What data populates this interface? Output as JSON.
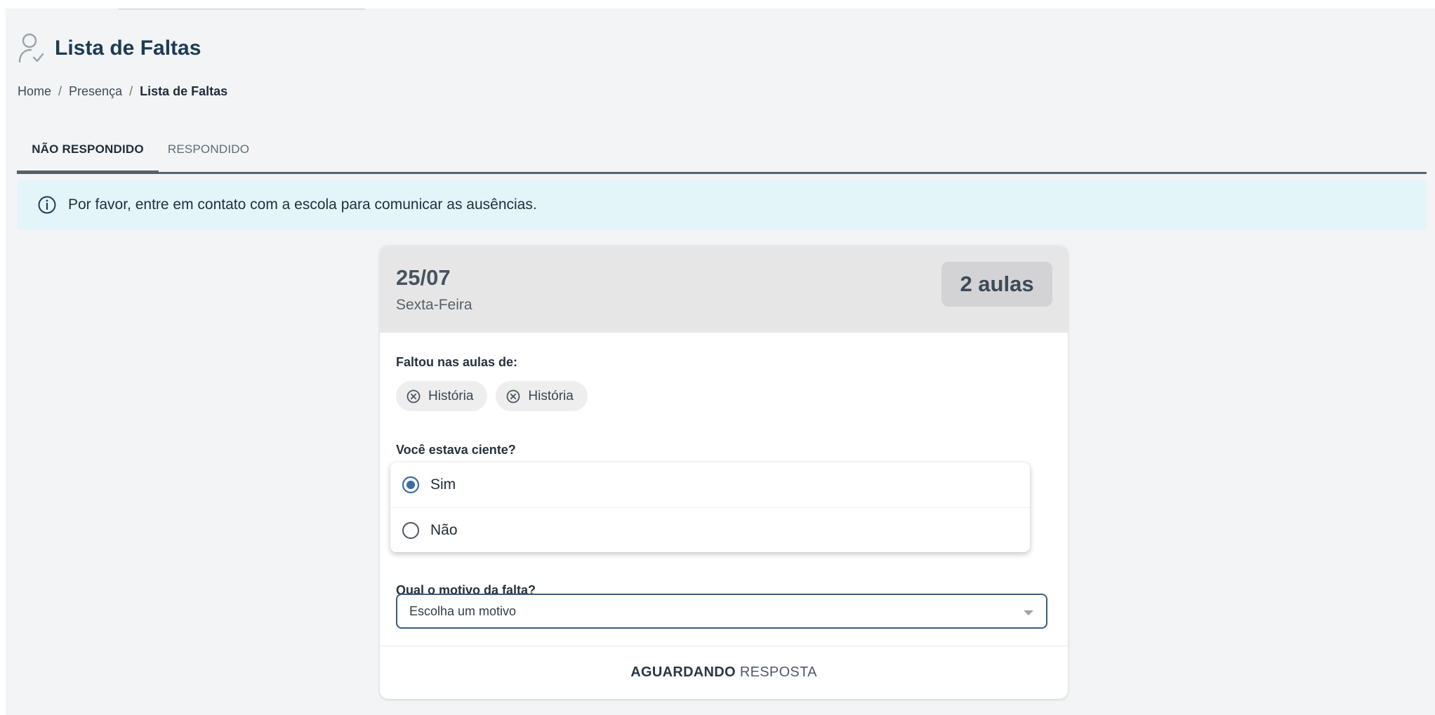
{
  "header": {
    "title": "Lista de Faltas",
    "icon": "user-check-icon"
  },
  "breadcrumb": {
    "items": [
      "Home",
      "Presença",
      "Lista de Faltas"
    ],
    "separator": "/"
  },
  "tabs": [
    {
      "label": "NÃO RESPONDIDO",
      "active": true
    },
    {
      "label": "RESPONDIDO",
      "active": false
    }
  ],
  "alert": {
    "icon": "info-icon",
    "text": "Por favor, entre em contato com a escola para comunicar as ausências."
  },
  "card": {
    "date": "25/07",
    "weekday": "Sexta-Feira",
    "badge": "2 aulas",
    "missed_label": "Faltou nas aulas de:",
    "missed_classes": [
      "História",
      "História"
    ],
    "aware_label": "Você estava ciente?",
    "aware_options": [
      {
        "label": "Sim",
        "selected": true
      },
      {
        "label": "Não",
        "selected": false
      }
    ],
    "reason_label": "Qual o motivo da falta?",
    "reason_placeholder": "Escolha um motivo",
    "footer_strong": "AGUARDANDO",
    "footer_rest": "RESPOSTA"
  },
  "colors": {
    "accent": "#3a6ea5",
    "title": "#1d3b52",
    "alert_bg": "#e4f5f9",
    "card_head": "#e6e6e7"
  }
}
